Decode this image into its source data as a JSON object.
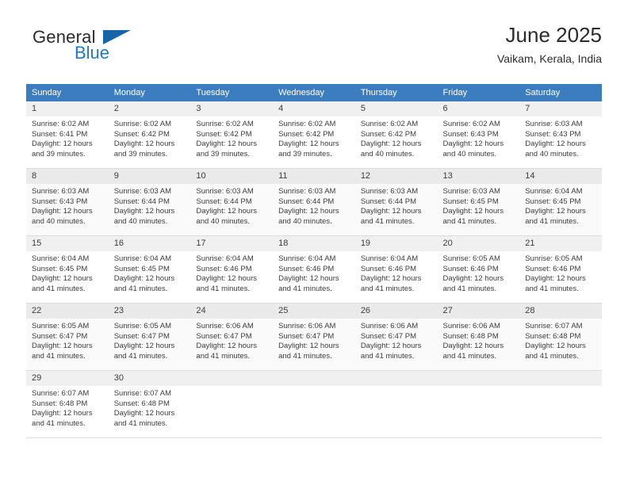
{
  "brand": {
    "name_top": "General",
    "name_bottom": "Blue",
    "triangle_color": "#1665a8",
    "blue_color": "#1f7ac0"
  },
  "header": {
    "title": "June 2025",
    "subtitle": "Vaikam, Kerala, India"
  },
  "theme": {
    "header_bg": "#3b7dbf",
    "daynum_bg": "#f0f0f0",
    "row_border": "#dcdcdc",
    "text": "#3c3c3c"
  },
  "weekday_headers": [
    "Sunday",
    "Monday",
    "Tuesday",
    "Wednesday",
    "Thursday",
    "Friday",
    "Saturday"
  ],
  "weeks": [
    {
      "shaded": false,
      "days": [
        {
          "num": "1",
          "sunrise": "Sunrise: 6:02 AM",
          "sunset": "Sunset: 6:41 PM",
          "daylight1": "Daylight: 12 hours",
          "daylight2": "and 39 minutes."
        },
        {
          "num": "2",
          "sunrise": "Sunrise: 6:02 AM",
          "sunset": "Sunset: 6:42 PM",
          "daylight1": "Daylight: 12 hours",
          "daylight2": "and 39 minutes."
        },
        {
          "num": "3",
          "sunrise": "Sunrise: 6:02 AM",
          "sunset": "Sunset: 6:42 PM",
          "daylight1": "Daylight: 12 hours",
          "daylight2": "and 39 minutes."
        },
        {
          "num": "4",
          "sunrise": "Sunrise: 6:02 AM",
          "sunset": "Sunset: 6:42 PM",
          "daylight1": "Daylight: 12 hours",
          "daylight2": "and 39 minutes."
        },
        {
          "num": "5",
          "sunrise": "Sunrise: 6:02 AM",
          "sunset": "Sunset: 6:42 PM",
          "daylight1": "Daylight: 12 hours",
          "daylight2": "and 40 minutes."
        },
        {
          "num": "6",
          "sunrise": "Sunrise: 6:02 AM",
          "sunset": "Sunset: 6:43 PM",
          "daylight1": "Daylight: 12 hours",
          "daylight2": "and 40 minutes."
        },
        {
          "num": "7",
          "sunrise": "Sunrise: 6:03 AM",
          "sunset": "Sunset: 6:43 PM",
          "daylight1": "Daylight: 12 hours",
          "daylight2": "and 40 minutes."
        }
      ]
    },
    {
      "shaded": true,
      "days": [
        {
          "num": "8",
          "sunrise": "Sunrise: 6:03 AM",
          "sunset": "Sunset: 6:43 PM",
          "daylight1": "Daylight: 12 hours",
          "daylight2": "and 40 minutes."
        },
        {
          "num": "9",
          "sunrise": "Sunrise: 6:03 AM",
          "sunset": "Sunset: 6:44 PM",
          "daylight1": "Daylight: 12 hours",
          "daylight2": "and 40 minutes."
        },
        {
          "num": "10",
          "sunrise": "Sunrise: 6:03 AM",
          "sunset": "Sunset: 6:44 PM",
          "daylight1": "Daylight: 12 hours",
          "daylight2": "and 40 minutes."
        },
        {
          "num": "11",
          "sunrise": "Sunrise: 6:03 AM",
          "sunset": "Sunset: 6:44 PM",
          "daylight1": "Daylight: 12 hours",
          "daylight2": "and 40 minutes."
        },
        {
          "num": "12",
          "sunrise": "Sunrise: 6:03 AM",
          "sunset": "Sunset: 6:44 PM",
          "daylight1": "Daylight: 12 hours",
          "daylight2": "and 41 minutes."
        },
        {
          "num": "13",
          "sunrise": "Sunrise: 6:03 AM",
          "sunset": "Sunset: 6:45 PM",
          "daylight1": "Daylight: 12 hours",
          "daylight2": "and 41 minutes."
        },
        {
          "num": "14",
          "sunrise": "Sunrise: 6:04 AM",
          "sunset": "Sunset: 6:45 PM",
          "daylight1": "Daylight: 12 hours",
          "daylight2": "and 41 minutes."
        }
      ]
    },
    {
      "shaded": false,
      "days": [
        {
          "num": "15",
          "sunrise": "Sunrise: 6:04 AM",
          "sunset": "Sunset: 6:45 PM",
          "daylight1": "Daylight: 12 hours",
          "daylight2": "and 41 minutes."
        },
        {
          "num": "16",
          "sunrise": "Sunrise: 6:04 AM",
          "sunset": "Sunset: 6:45 PM",
          "daylight1": "Daylight: 12 hours",
          "daylight2": "and 41 minutes."
        },
        {
          "num": "17",
          "sunrise": "Sunrise: 6:04 AM",
          "sunset": "Sunset: 6:46 PM",
          "daylight1": "Daylight: 12 hours",
          "daylight2": "and 41 minutes."
        },
        {
          "num": "18",
          "sunrise": "Sunrise: 6:04 AM",
          "sunset": "Sunset: 6:46 PM",
          "daylight1": "Daylight: 12 hours",
          "daylight2": "and 41 minutes."
        },
        {
          "num": "19",
          "sunrise": "Sunrise: 6:04 AM",
          "sunset": "Sunset: 6:46 PM",
          "daylight1": "Daylight: 12 hours",
          "daylight2": "and 41 minutes."
        },
        {
          "num": "20",
          "sunrise": "Sunrise: 6:05 AM",
          "sunset": "Sunset: 6:46 PM",
          "daylight1": "Daylight: 12 hours",
          "daylight2": "and 41 minutes."
        },
        {
          "num": "21",
          "sunrise": "Sunrise: 6:05 AM",
          "sunset": "Sunset: 6:46 PM",
          "daylight1": "Daylight: 12 hours",
          "daylight2": "and 41 minutes."
        }
      ]
    },
    {
      "shaded": true,
      "days": [
        {
          "num": "22",
          "sunrise": "Sunrise: 6:05 AM",
          "sunset": "Sunset: 6:47 PM",
          "daylight1": "Daylight: 12 hours",
          "daylight2": "and 41 minutes."
        },
        {
          "num": "23",
          "sunrise": "Sunrise: 6:05 AM",
          "sunset": "Sunset: 6:47 PM",
          "daylight1": "Daylight: 12 hours",
          "daylight2": "and 41 minutes."
        },
        {
          "num": "24",
          "sunrise": "Sunrise: 6:06 AM",
          "sunset": "Sunset: 6:47 PM",
          "daylight1": "Daylight: 12 hours",
          "daylight2": "and 41 minutes."
        },
        {
          "num": "25",
          "sunrise": "Sunrise: 6:06 AM",
          "sunset": "Sunset: 6:47 PM",
          "daylight1": "Daylight: 12 hours",
          "daylight2": "and 41 minutes."
        },
        {
          "num": "26",
          "sunrise": "Sunrise: 6:06 AM",
          "sunset": "Sunset: 6:47 PM",
          "daylight1": "Daylight: 12 hours",
          "daylight2": "and 41 minutes."
        },
        {
          "num": "27",
          "sunrise": "Sunrise: 6:06 AM",
          "sunset": "Sunset: 6:48 PM",
          "daylight1": "Daylight: 12 hours",
          "daylight2": "and 41 minutes."
        },
        {
          "num": "28",
          "sunrise": "Sunrise: 6:07 AM",
          "sunset": "Sunset: 6:48 PM",
          "daylight1": "Daylight: 12 hours",
          "daylight2": "and 41 minutes."
        }
      ]
    },
    {
      "shaded": false,
      "days": [
        {
          "num": "29",
          "sunrise": "Sunrise: 6:07 AM",
          "sunset": "Sunset: 6:48 PM",
          "daylight1": "Daylight: 12 hours",
          "daylight2": "and 41 minutes."
        },
        {
          "num": "30",
          "sunrise": "Sunrise: 6:07 AM",
          "sunset": "Sunset: 6:48 PM",
          "daylight1": "Daylight: 12 hours",
          "daylight2": "and 41 minutes."
        },
        null,
        null,
        null,
        null,
        null
      ]
    }
  ]
}
